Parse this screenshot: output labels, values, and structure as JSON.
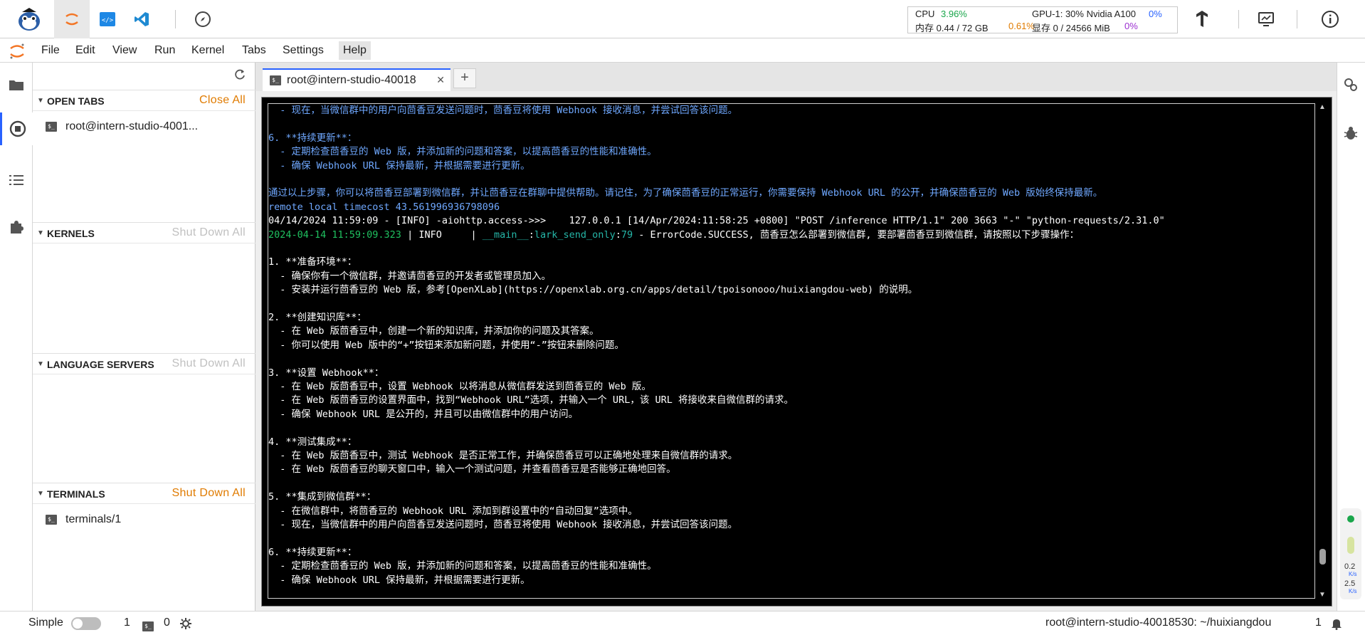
{
  "topbar": {
    "stats": {
      "cpu_label": "CPU",
      "cpu_value": "3.96%",
      "mem_label": "内存 0.44 / 72 GB",
      "mem_pct": "0.61%",
      "gpu_label": "GPU-1: 30% Nvidia A100",
      "gpu_pct": "0%",
      "vram_label": "显存 0 / 24566 MiB",
      "vram_pct": "0%"
    },
    "icons": [
      "mascot-logo",
      "jupyter-icon",
      "code-icon",
      "vscode-icon",
      "compass-icon",
      "tensorflow-icon",
      "monitor-icon",
      "info-icon"
    ]
  },
  "menu": {
    "items": [
      "File",
      "Edit",
      "View",
      "Run",
      "Kernel",
      "Tabs",
      "Settings",
      "Help"
    ]
  },
  "sidebar": {
    "open_tabs": {
      "title": "OPEN TABS",
      "action": "Close All",
      "items": [
        "root@intern-studio-4001..."
      ]
    },
    "kernels": {
      "title": "KERNELS",
      "action": "Shut Down All"
    },
    "language_servers": {
      "title": "LANGUAGE SERVERS",
      "action": "Shut Down All"
    },
    "terminals": {
      "title": "TERMINALS",
      "action": "Shut Down All",
      "items": [
        "terminals/1"
      ]
    }
  },
  "tab": {
    "label": "root@intern-studio-40018",
    "close": "✕",
    "add": "+"
  },
  "terminal": {
    "lines": [
      {
        "segs": [
          {
            "t": "  - 现在，当微信群中的用户向茴香豆发送问题时，茴香豆将使用 Webhook 接收消息，并尝试回答该问题。",
            "c": "blue"
          }
        ]
      },
      {
        "segs": [
          {
            "t": "",
            "c": "blue"
          }
        ]
      },
      {
        "segs": [
          {
            "t": "6. **持续更新**：",
            "c": "blue"
          }
        ]
      },
      {
        "segs": [
          {
            "t": "  - 定期检查茴香豆的 Web 版，并添加新的问题和答案，以提高茴香豆的性能和准确性。",
            "c": "blue"
          }
        ]
      },
      {
        "segs": [
          {
            "t": "  - 确保 Webhook URL 保持最新，并根据需要进行更新。",
            "c": "blue"
          }
        ]
      },
      {
        "segs": [
          {
            "t": "",
            "c": "blue"
          }
        ]
      },
      {
        "segs": [
          {
            "t": "通过以上步骤，你可以将茴香豆部署到微信群，并让茴香豆在群聊中提供帮助。请记住，为了确保茴香豆的正常运行，你需要保持 Webhook URL 的公开，并确保茴香豆的 Web 版始终保持最新。",
            "c": "blue"
          }
        ]
      },
      {
        "segs": [
          {
            "t": "remote local timecost 43.561996936798096",
            "c": "blue"
          }
        ]
      },
      {
        "segs": [
          {
            "t": "04/14/2024 11:59:09 - [INFO] -aiohttp.access->>>    127.0.0.1 [14/Apr/2024:11:58:25 +0800] \"POST /inference HTTP/1.1\" 200 3663 \"-\" \"python-requests/2.31.0\"",
            "c": "white"
          }
        ]
      },
      {
        "segs": [
          {
            "t": "2024-04-14 11:59:09.323",
            "c": "green"
          },
          {
            "t": " | INFO     | ",
            "c": "white"
          },
          {
            "t": "__main__",
            "c": "teal"
          },
          {
            "t": ":",
            "c": "white"
          },
          {
            "t": "lark_send_only",
            "c": "teal"
          },
          {
            "t": ":",
            "c": "white"
          },
          {
            "t": "79",
            "c": "teal"
          },
          {
            "t": " - ErrorCode.SUCCESS, 茴香豆怎么部署到微信群, 要部署茴香豆到微信群，请按照以下步骤操作：",
            "c": "white"
          }
        ]
      },
      {
        "segs": [
          {
            "t": "",
            "c": "white"
          }
        ]
      },
      {
        "segs": [
          {
            "t": "1. **准备环境**：",
            "c": "white"
          }
        ]
      },
      {
        "segs": [
          {
            "t": "  - 确保你有一个微信群，并邀请茴香豆的开发者或管理员加入。",
            "c": "white"
          }
        ]
      },
      {
        "segs": [
          {
            "t": "  - 安装并运行茴香豆的 Web 版，参考[OpenXLab](https://openxlab.org.cn/apps/detail/tpoisonooo/huixiangdou-web) 的说明。",
            "c": "white"
          }
        ]
      },
      {
        "segs": [
          {
            "t": "",
            "c": "white"
          }
        ]
      },
      {
        "segs": [
          {
            "t": "2. **创建知识库**：",
            "c": "white"
          }
        ]
      },
      {
        "segs": [
          {
            "t": "  - 在 Web 版茴香豆中，创建一个新的知识库，并添加你的问题及其答案。",
            "c": "white"
          }
        ]
      },
      {
        "segs": [
          {
            "t": "  - 你可以使用 Web 版中的“+”按钮来添加新问题，并使用“-”按钮来删除问题。",
            "c": "white"
          }
        ]
      },
      {
        "segs": [
          {
            "t": "",
            "c": "white"
          }
        ]
      },
      {
        "segs": [
          {
            "t": "3. **设置 Webhook**：",
            "c": "white"
          }
        ]
      },
      {
        "segs": [
          {
            "t": "  - 在 Web 版茴香豆中，设置 Webhook 以将消息从微信群发送到茴香豆的 Web 版。",
            "c": "white"
          }
        ]
      },
      {
        "segs": [
          {
            "t": "  - 在 Web 版茴香豆的设置界面中，找到“Webhook URL”选项，并输入一个 URL，该 URL 将接收来自微信群的请求。",
            "c": "white"
          }
        ]
      },
      {
        "segs": [
          {
            "t": "  - 确保 Webhook URL 是公开的，并且可以由微信群中的用户访问。",
            "c": "white"
          }
        ]
      },
      {
        "segs": [
          {
            "t": "",
            "c": "white"
          }
        ]
      },
      {
        "segs": [
          {
            "t": "4. **测试集成**：",
            "c": "white"
          }
        ]
      },
      {
        "segs": [
          {
            "t": "  - 在 Web 版茴香豆中，测试 Webhook 是否正常工作，并确保茴香豆可以正确地处理来自微信群的请求。",
            "c": "white"
          }
        ]
      },
      {
        "segs": [
          {
            "t": "  - 在 Web 版茴香豆的聊天窗口中，输入一个测试问题，并查看茴香豆是否能够正确地回答。",
            "c": "white"
          }
        ]
      },
      {
        "segs": [
          {
            "t": "",
            "c": "white"
          }
        ]
      },
      {
        "segs": [
          {
            "t": "5. **集成到微信群**：",
            "c": "white"
          }
        ]
      },
      {
        "segs": [
          {
            "t": "  - 在微信群中，将茴香豆的 Webhook URL 添加到群设置中的“自动回复”选项中。",
            "c": "white"
          }
        ]
      },
      {
        "segs": [
          {
            "t": "  - 现在，当微信群中的用户向茴香豆发送问题时，茴香豆将使用 Webhook 接收消息，并尝试回答该问题。",
            "c": "white"
          }
        ]
      },
      {
        "segs": [
          {
            "t": "",
            "c": "white"
          }
        ]
      },
      {
        "segs": [
          {
            "t": "6. **持续更新**：",
            "c": "white"
          }
        ]
      },
      {
        "segs": [
          {
            "t": "  - 定期检查茴香豆的 Web 版，并添加新的问题和答案，以提高茴香豆的性能和准确性。",
            "c": "white"
          }
        ]
      },
      {
        "segs": [
          {
            "t": "  - 确保 Webhook URL 保持最新，并根据需要进行更新。",
            "c": "white"
          }
        ]
      }
    ]
  },
  "rightbar": {
    "net_up": "0.2",
    "net_up_unit": "K/s",
    "net_down": "2.5",
    "net_down_unit": "K/s"
  },
  "statusbar": {
    "mode": "Simple",
    "count1": "1",
    "count2": "0",
    "path": "root@intern-studio-40018530: ~/huixiangdou",
    "right_num": "1"
  },
  "colors": {
    "accent_orange": "#e07b00",
    "tab_blue": "#2962ff",
    "term_blue": "#6fa8ff"
  }
}
